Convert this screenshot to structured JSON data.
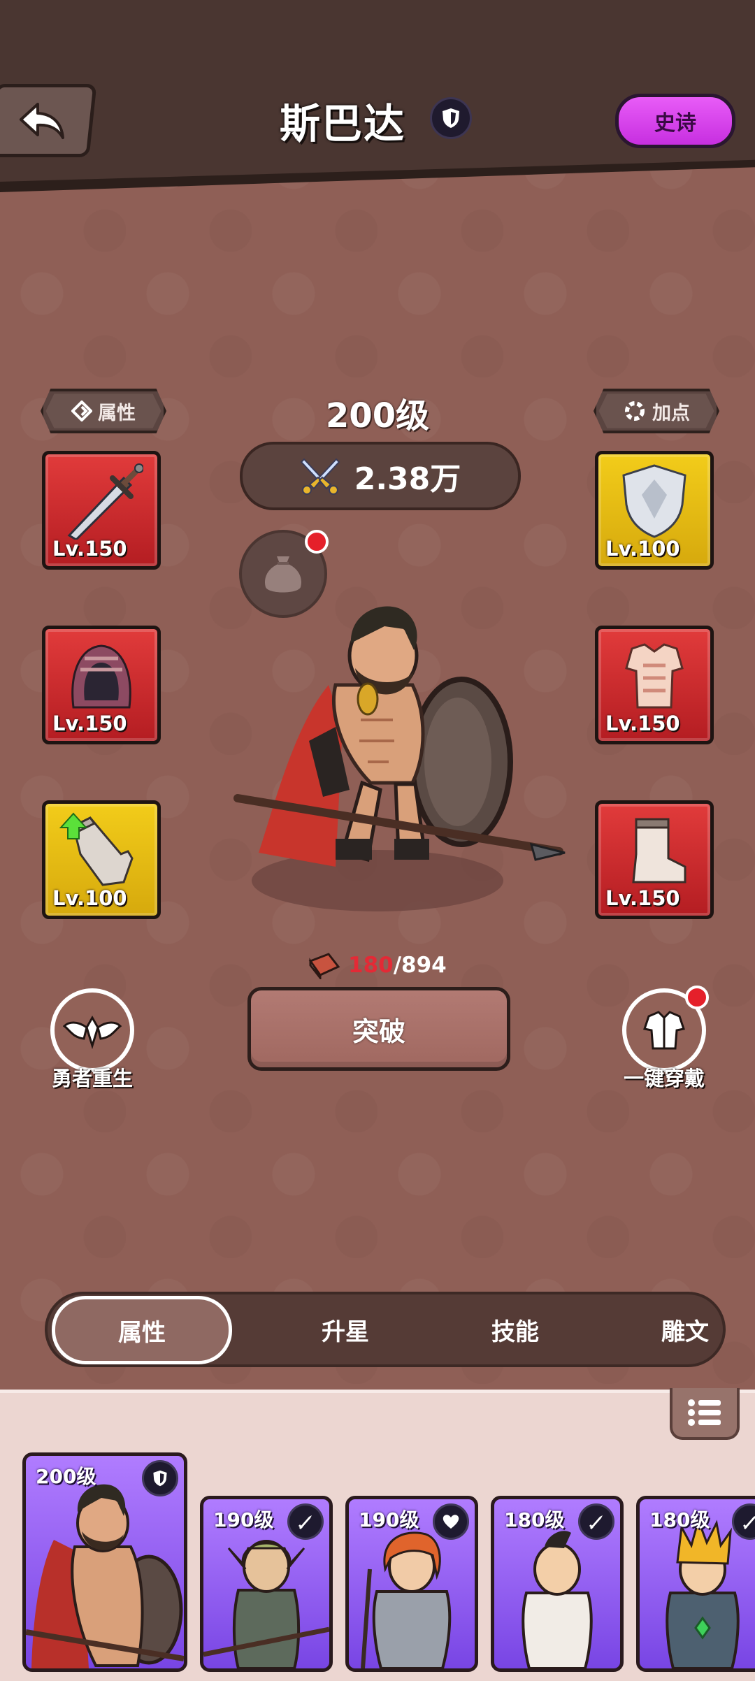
{
  "header": {
    "hero_name": "斯巴达",
    "rarity": "史诗",
    "back_icon": "back-arrow-icon",
    "class_icon": "shield-icon"
  },
  "main": {
    "attributes_button": "属性",
    "add_points_button": "加点",
    "level": "200级",
    "power": "2.38万",
    "material": {
      "have": "180",
      "need": "/894"
    },
    "breakthrough_button": "突破",
    "rebirth_label": "勇者重生",
    "equip_all_label": "一键穿戴"
  },
  "equipment": [
    {
      "slot": "weapon",
      "icon": "sword-icon",
      "level": "Lv.150",
      "rarity_color": "#d42c2f"
    },
    {
      "slot": "helmet",
      "icon": "hood-icon",
      "level": "Lv.150",
      "rarity_color": "#d42c2f"
    },
    {
      "slot": "gloves",
      "icon": "glove-icon",
      "level": "Lv.100",
      "rarity_color": "#e8bd12",
      "upgradable": true
    },
    {
      "slot": "shield",
      "icon": "shield-emblem-icon",
      "level": "Lv.100",
      "rarity_color": "#e8bd12"
    },
    {
      "slot": "armor",
      "icon": "chest-armor-icon",
      "level": "Lv.150",
      "rarity_color": "#d42c2f"
    },
    {
      "slot": "boots",
      "icon": "boot-icon",
      "level": "Lv.150",
      "rarity_color": "#d42c2f"
    }
  ],
  "tabs": [
    {
      "label": "属性",
      "active": true
    },
    {
      "label": "升星",
      "active": false
    },
    {
      "label": "技能",
      "active": false
    },
    {
      "label": "雕文",
      "active": false
    }
  ],
  "roster": [
    {
      "level": "200级",
      "class_icon": "shield-icon",
      "selected": true
    },
    {
      "level": "190级",
      "class_icon": "sword-icon"
    },
    {
      "level": "190级",
      "class_icon": "heart-icon"
    },
    {
      "level": "180级",
      "class_icon": "sword-icon"
    },
    {
      "level": "180级",
      "class_icon": "sword-icon"
    }
  ],
  "colors": {
    "background": "#8f5f56",
    "header": "#4a3631",
    "epic_purple": "#d845ef",
    "red_rarity": "#d42c2f",
    "gold_rarity": "#e8bd12",
    "material_red": "#e32a36"
  }
}
